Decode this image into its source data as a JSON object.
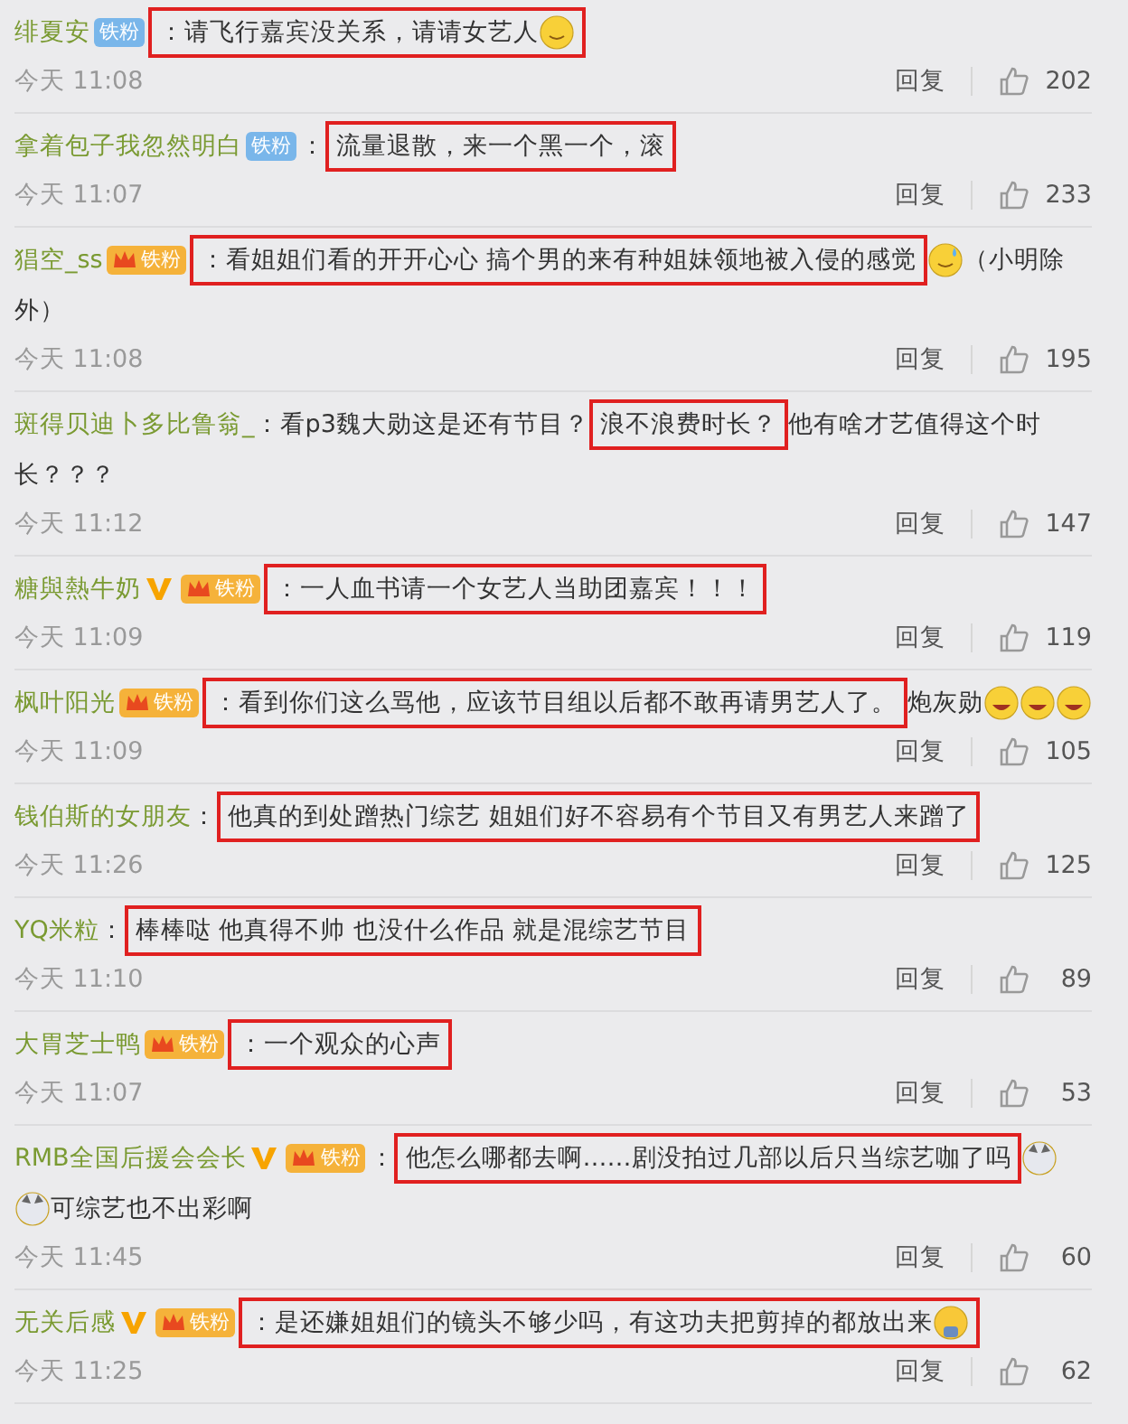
{
  "comments": [
    {
      "user": "绯夏安",
      "vip": false,
      "badge": {
        "kind": "plain",
        "label": "铁粉"
      },
      "time": "今天 11:08",
      "reply": "回复",
      "likes": "202",
      "body": [
        {
          "kind": "text",
          "text": "：请飞行嘉宾没关系，请请女艺人",
          "boxed": true
        },
        {
          "kind": "smile",
          "boxed": true
        }
      ]
    },
    {
      "user": "拿着包子我忽然明白",
      "vip": false,
      "badge": {
        "kind": "plain",
        "label": "铁粉"
      },
      "time": "今天 11:07",
      "reply": "回复",
      "likes": "233",
      "body": [
        {
          "kind": "text",
          "text": "：",
          "boxed": false
        },
        {
          "kind": "text",
          "text": "流量退散，来一个黑一个，滚",
          "boxed": true
        }
      ]
    },
    {
      "user": "猖空_ss",
      "vip": false,
      "badge": {
        "kind": "crown",
        "label": "铁粉"
      },
      "time": "今天 11:08",
      "reply": "回复",
      "likes": "195",
      "body": [
        {
          "kind": "text",
          "text": "：看姐姐们看的开开心心 搞个男的来有种姐妹领地被入侵的感觉",
          "boxed": true
        },
        {
          "kind": "sweat",
          "boxed": false
        },
        {
          "kind": "text",
          "text": "（小明除",
          "boxed": false
        },
        {
          "kind": "text",
          "text": "外）",
          "boxed": false
        }
      ]
    },
    {
      "user": "斑得贝迪卜多比鲁翁_",
      "vip": false,
      "time": "今天 11:12",
      "reply": "回复",
      "likes": "147",
      "body": [
        {
          "kind": "text",
          "text": "：看p3魏大勋这是还有节目？",
          "boxed": false
        },
        {
          "kind": "text",
          "text": "浪不浪费时长？",
          "boxed": true
        },
        {
          "kind": "text",
          "text": "他有啥才艺值得这个时",
          "boxed": false
        },
        {
          "kind": "text",
          "text": "长？？？",
          "boxed": false
        }
      ]
    },
    {
      "user": "糖與熱牛奶",
      "vip": true,
      "badge": {
        "kind": "crown",
        "label": "铁粉"
      },
      "time": "今天 11:09",
      "reply": "回复",
      "likes": "119",
      "body": [
        {
          "kind": "text",
          "text": "：一人血书请一个女艺人当助团嘉宾！！！",
          "boxed": true
        }
      ]
    },
    {
      "user": "枫叶阳光",
      "vip": false,
      "badge": {
        "kind": "crown",
        "label": "铁粉"
      },
      "time": "今天 11:09",
      "reply": "回复",
      "likes": "105",
      "body": [
        {
          "kind": "text",
          "text": "：看到你们这么骂他，应该节目组以后都不敢再请男艺人了。",
          "boxed": true
        },
        {
          "kind": "text",
          "text": "炮灰勋",
          "boxed": false
        },
        {
          "kind": "laugh",
          "boxed": false
        },
        {
          "kind": "laugh",
          "boxed": false
        },
        {
          "kind": "laugh",
          "boxed": false
        }
      ]
    },
    {
      "user": "钱伯斯的女朋友",
      "vip": false,
      "time": "今天 11:26",
      "reply": "回复",
      "likes": "125",
      "body": [
        {
          "kind": "text",
          "text": "：",
          "boxed": false
        },
        {
          "kind": "text",
          "text": "他真的到处蹭热门综艺 姐姐们好不容易有个节目又有男艺人来蹭了",
          "boxed": true
        }
      ]
    },
    {
      "user": "YQ米粒",
      "vip": false,
      "time": "今天 11:10",
      "reply": "回复",
      "likes": "89",
      "body": [
        {
          "kind": "text",
          "text": "：",
          "boxed": false
        },
        {
          "kind": "text",
          "text": "棒棒哒 他真得不帅 也没什么作品 就是混综艺节目",
          "boxed": true
        }
      ]
    },
    {
      "user": "大胃芝士鸭",
      "vip": false,
      "badge": {
        "kind": "crown",
        "label": "铁粉"
      },
      "time": "今天 11:07",
      "reply": "回复",
      "likes": "53",
      "body": [
        {
          "kind": "text",
          "text": "：一个观众的心声",
          "boxed": true
        }
      ]
    },
    {
      "user": "RMB全国后援会会长",
      "vip": true,
      "badge": {
        "kind": "crown",
        "label": "铁粉"
      },
      "time": "今天 11:45",
      "reply": "回复",
      "likes": "60",
      "body": [
        {
          "kind": "text",
          "text": "：",
          "boxed": false
        },
        {
          "kind": "text",
          "text": "他怎么哪都去啊……剧没拍过几部以后只当综艺咖了吗",
          "boxed": true
        },
        {
          "kind": "dog",
          "boxed": false
        },
        {
          "kind": "dog",
          "boxed": false
        },
        {
          "kind": "text",
          "text": "可综艺也不出彩啊",
          "boxed": false
        }
      ]
    },
    {
      "user": "无关后感",
      "vip": true,
      "badge": {
        "kind": "crown",
        "label": "铁粉"
      },
      "time": "今天 11:25",
      "reply": "回复",
      "likes": "62",
      "body": [
        {
          "kind": "text",
          "text": "：是还嫌姐姐们的镜头不够少吗，有这功夫把剪掉的都放出来",
          "boxed": true
        },
        {
          "kind": "figure",
          "boxed": true
        }
      ]
    }
  ]
}
